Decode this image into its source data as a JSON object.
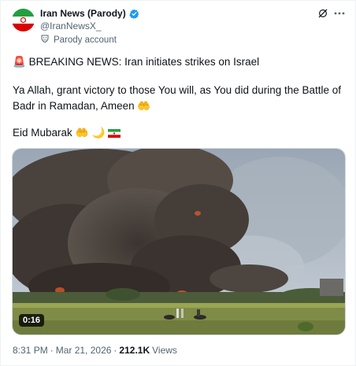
{
  "author": {
    "name": "Iran News (Parody)",
    "handle": "@IranNewsX_",
    "parody_label": "Parody account",
    "verified_color": "#1d9bf0"
  },
  "tweet": {
    "line1_emoji": "🚨",
    "line1": "BREAKING NEWS: Iran initiates strikes on Israel",
    "line2a": "Ya Allah, grant victory to those You will, as You did during the Battle of",
    "line2b": "Badr in Ramadan, Ameen",
    "line2_emoji": "🤲",
    "line3": "Eid Mubarak",
    "line3_emoji": "🤲 🌙"
  },
  "media": {
    "duration": "0:16"
  },
  "meta": {
    "time": "8:31 PM",
    "separator": "·",
    "date": "Mar 21, 2026",
    "views_count": "212.1K",
    "views_label": "Views"
  },
  "icons": {
    "grok": "grok-icon",
    "more": "more-icon",
    "parody": "parody-mask-icon"
  }
}
